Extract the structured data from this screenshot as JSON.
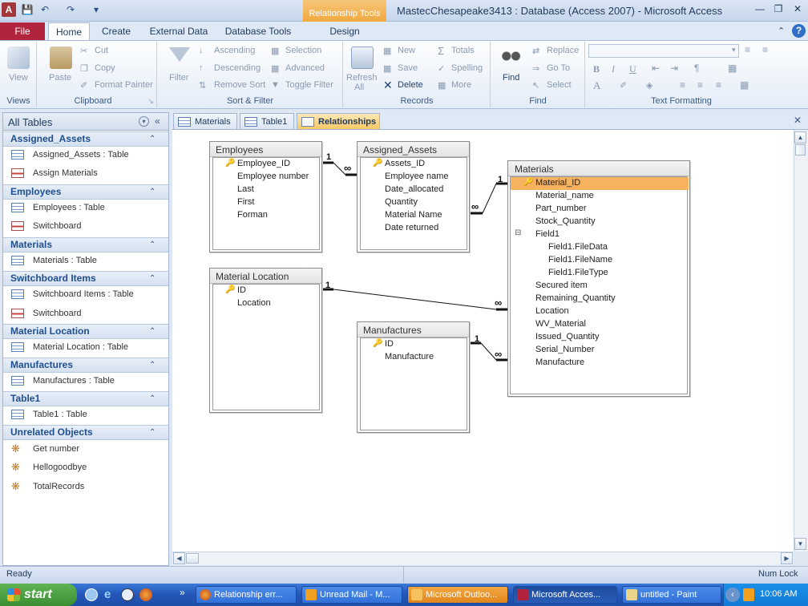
{
  "window": {
    "title": "MastecChesapeake3413 : Database (Access 2007) - Microsoft Access",
    "context_tab": "Relationship Tools"
  },
  "ribbon": {
    "tabs": [
      "File",
      "Home",
      "Create",
      "External Data",
      "Database Tools",
      "Design"
    ],
    "groups": {
      "views": {
        "label": "Views",
        "view": "View"
      },
      "clipboard": {
        "label": "Clipboard",
        "paste": "Paste",
        "cut": "Cut",
        "copy": "Copy",
        "format_painter": "Format Painter"
      },
      "sort_filter": {
        "label": "Sort & Filter",
        "filter": "Filter",
        "ascending": "Ascending",
        "descending": "Descending",
        "remove_sort": "Remove Sort",
        "selection": "Selection",
        "advanced": "Advanced",
        "toggle_filter": "Toggle Filter"
      },
      "records": {
        "label": "Records",
        "refresh": "Refresh",
        "refresh_sub": "All",
        "new": "New",
        "save": "Save",
        "delete": "Delete",
        "totals": "Totals",
        "spelling": "Spelling",
        "more": "More"
      },
      "find": {
        "label": "Find",
        "find": "Find",
        "replace": "Replace",
        "goto": "Go To",
        "select": "Select"
      },
      "text_formatting": {
        "label": "Text Formatting",
        "bold": "B",
        "italic": "I",
        "underline": "U"
      }
    }
  },
  "nav": {
    "header": "All Tables",
    "groups": [
      {
        "label": "Assigned_Assets",
        "items": [
          {
            "label": "Assigned_Assets : Table",
            "type": "table"
          },
          {
            "label": "Assign Materials",
            "type": "form"
          }
        ]
      },
      {
        "label": "Employees",
        "items": [
          {
            "label": "Employees : Table",
            "type": "table"
          },
          {
            "label": "Switchboard",
            "type": "form"
          }
        ]
      },
      {
        "label": "Materials",
        "items": [
          {
            "label": "Materials : Table",
            "type": "table"
          }
        ]
      },
      {
        "label": "Switchboard Items",
        "items": [
          {
            "label": "Switchboard Items : Table",
            "type": "table"
          },
          {
            "label": "Switchboard",
            "type": "form"
          }
        ]
      },
      {
        "label": "Material Location",
        "items": [
          {
            "label": "Material Location : Table",
            "type": "table"
          }
        ]
      },
      {
        "label": "Manufactures",
        "items": [
          {
            "label": "Manufactures : Table",
            "type": "table"
          }
        ]
      },
      {
        "label": "Table1",
        "items": [
          {
            "label": "Table1 : Table",
            "type": "table"
          }
        ]
      },
      {
        "label": "Unrelated Objects",
        "items": [
          {
            "label": "Get number",
            "type": "macro"
          },
          {
            "label": "Hellogoodbye",
            "type": "macro"
          },
          {
            "label": "TotalRecords",
            "type": "macro"
          }
        ]
      }
    ]
  },
  "doc_tabs": [
    "Materials",
    "Table1",
    "Relationships"
  ],
  "tables": {
    "employees": {
      "title": "Employees",
      "fields": [
        "Employee_ID",
        "Employee number",
        "Last",
        "First",
        "Forman"
      ]
    },
    "assigned_assets": {
      "title": "Assigned_Assets",
      "fields": [
        "Assets_ID",
        "Employee name",
        "Date_allocated",
        "Quantity",
        "Material Name",
        "Date returned"
      ]
    },
    "materials": {
      "title": "Materials",
      "fields": [
        "Material_ID",
        "Material_name",
        "Part_number",
        "Stock_Quantity",
        "Field1",
        "Field1.FileData",
        "Field1.FileName",
        "Field1.FileType",
        "Secured item",
        "Remaining_Quantity",
        "Location",
        "WV_Material",
        "Issued_Quantity",
        "Serial_Number",
        "Manufacture"
      ]
    },
    "material_location": {
      "title": "Material Location",
      "fields": [
        "ID",
        "Location"
      ]
    },
    "manufactures": {
      "title": "Manufactures",
      "fields": [
        "ID",
        "Manufacture"
      ]
    }
  },
  "relationships": {
    "one": "1",
    "many": "∞"
  },
  "status": {
    "left": "Ready",
    "right": "Num Lock"
  },
  "taskbar": {
    "start": "start",
    "buttons": [
      "Relationship err...",
      "Unread Mail - M...",
      "Microsoft Outloo...",
      "Microsoft Acces...",
      "untitled - Paint"
    ],
    "clock": "10:06 AM"
  },
  "colors": {
    "file_tab": "#b2243d",
    "context_tab": "#f0a73b",
    "selected_field": "#f7b25f",
    "taskbar": "#2356b7"
  }
}
